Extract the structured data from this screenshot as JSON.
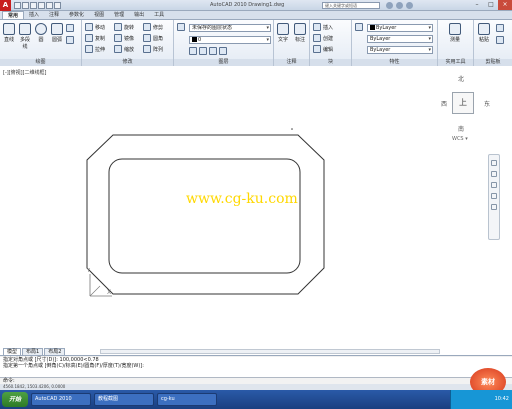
{
  "title_bar": {
    "app_logo": "A",
    "title": "AutoCAD 2010   Drawing1.dwg",
    "search_placeholder": "键入关键字或短语",
    "minimize": "–",
    "maximize": "□",
    "close": "×"
  },
  "ribbon_tabs": [
    "常用",
    "插入",
    "注释",
    "参数化",
    "视图",
    "管理",
    "输出",
    "工具"
  ],
  "ribbon": {
    "draw_panel": {
      "title": "绘图",
      "big_tools": [
        "直线",
        "多段线",
        "圆",
        "圆弧"
      ]
    },
    "modify_panel": {
      "title": "修改",
      "tools": [
        "移动",
        "旋转",
        "修剪",
        "复制",
        "镜像",
        "圆角",
        "拉伸",
        "缩放",
        "阵列"
      ]
    },
    "layers_panel": {
      "title": "图层",
      "layer_value": "未保存的图层状态",
      "current_layer": "0"
    },
    "annotation_panel": {
      "title": "注释",
      "big_tools": [
        "文字",
        "标注"
      ]
    },
    "block_panel": {
      "title": "块",
      "tools": [
        "插入",
        "创建",
        "编辑"
      ]
    },
    "properties_panel": {
      "title": "特性",
      "color": "ByLayer",
      "linetype": "ByLayer",
      "lineweight": "ByLayer"
    },
    "utilities_panel": {
      "title": "实用工具",
      "tool": "测量"
    },
    "clipboard_panel": {
      "title": "剪贴板",
      "tool": "粘贴"
    }
  },
  "canvas": {
    "viewport_label": "[-][俯视][二维线框]",
    "viewcube": {
      "north": "北",
      "south": "南",
      "east": "东",
      "west": "西",
      "face": "上",
      "wcs": "WCS ▾"
    },
    "watermark": "www.cg-ku.com",
    "ucs_y": "Y",
    "ucs_x": "X"
  },
  "layout_tabs": [
    "模型",
    "布局1",
    "布局2"
  ],
  "command_history": [
    "指定对角点或 [尺寸(D)]: 100,0000<0.78",
    "指定第一个角点或 [倒角(C)/标高(E)/圆角(F)/厚度(T)/宽度(W)]:"
  ],
  "command_prompt": "命令:",
  "status_bar": "4560.1842, 1503.4206, 0.0000",
  "taskbar": {
    "start": "开始",
    "tasks": [
      "AutoCAD 2010",
      "教程截图",
      "cg-ku"
    ],
    "clock": "10:42"
  },
  "site_badge": "素材"
}
